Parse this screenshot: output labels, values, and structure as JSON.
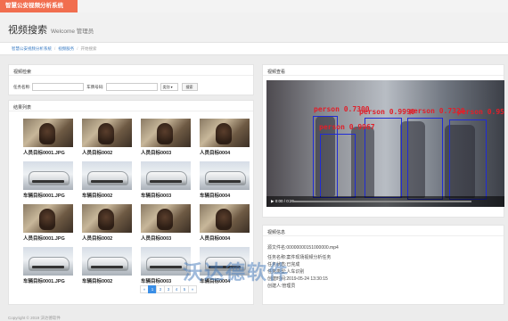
{
  "header": {
    "brand": "智慧公安视频分析系统"
  },
  "page": {
    "title": "视频搜索",
    "subtitle": "Welcome 管理员"
  },
  "breadcrumb": [
    "智慧公安视频分析系统",
    "视频服务",
    "开始搜索"
  ],
  "search": {
    "title": "视频检索",
    "task_label": "任务名称:",
    "plate_label": "车牌号码:",
    "select_value": "类别",
    "button": "搜索"
  },
  "results": {
    "title": "结果列表",
    "items": [
      {
        "label": "人员目标0001.JPG",
        "kind": "person"
      },
      {
        "label": "人员目标0002",
        "kind": "person"
      },
      {
        "label": "人员目标0003",
        "kind": "person"
      },
      {
        "label": "人员目标0004",
        "kind": "person"
      },
      {
        "label": "车辆目标0001.JPG",
        "kind": "car"
      },
      {
        "label": "车辆目标0002",
        "kind": "car"
      },
      {
        "label": "车辆目标0003",
        "kind": "car"
      },
      {
        "label": "车辆目标0004",
        "kind": "car"
      },
      {
        "label": "人员目标0001.JPG",
        "kind": "person"
      },
      {
        "label": "人员目标0002",
        "kind": "person"
      },
      {
        "label": "人员目标0003",
        "kind": "person"
      },
      {
        "label": "人员目标0004",
        "kind": "person"
      },
      {
        "label": "车辆目标0001.JPG",
        "kind": "car"
      },
      {
        "label": "车辆目标0002",
        "kind": "car"
      },
      {
        "label": "车辆目标0003",
        "kind": "car"
      },
      {
        "label": "车辆目标0004",
        "kind": "car"
      }
    ]
  },
  "pagination": {
    "prev": "«",
    "pages": [
      "1",
      "2",
      "3",
      "4",
      "5"
    ],
    "next": "»",
    "active": "1"
  },
  "video_panel": {
    "title": "视频查看",
    "detections": [
      {
        "label": "person 0.7300"
      },
      {
        "label": "person 0.9967"
      },
      {
        "label": "person 0.9990"
      },
      {
        "label": "person 0.7320"
      },
      {
        "label": "person 0.951"
      }
    ],
    "time": "0:00 / 0:26"
  },
  "video_info": {
    "title": "视频信息",
    "file": "源文件名:00000000151000000.mp4",
    "task": "任务名称:案件现场视频分析任务",
    "status": "任务状态:已完成",
    "type": "任务类型:人车识别",
    "time": "创建时间:2019-05-24 13:30:15",
    "creator": "创建人:管理员"
  },
  "watermark": "沃达德软件",
  "footer": "Copyright © 2019 沃达德软件"
}
